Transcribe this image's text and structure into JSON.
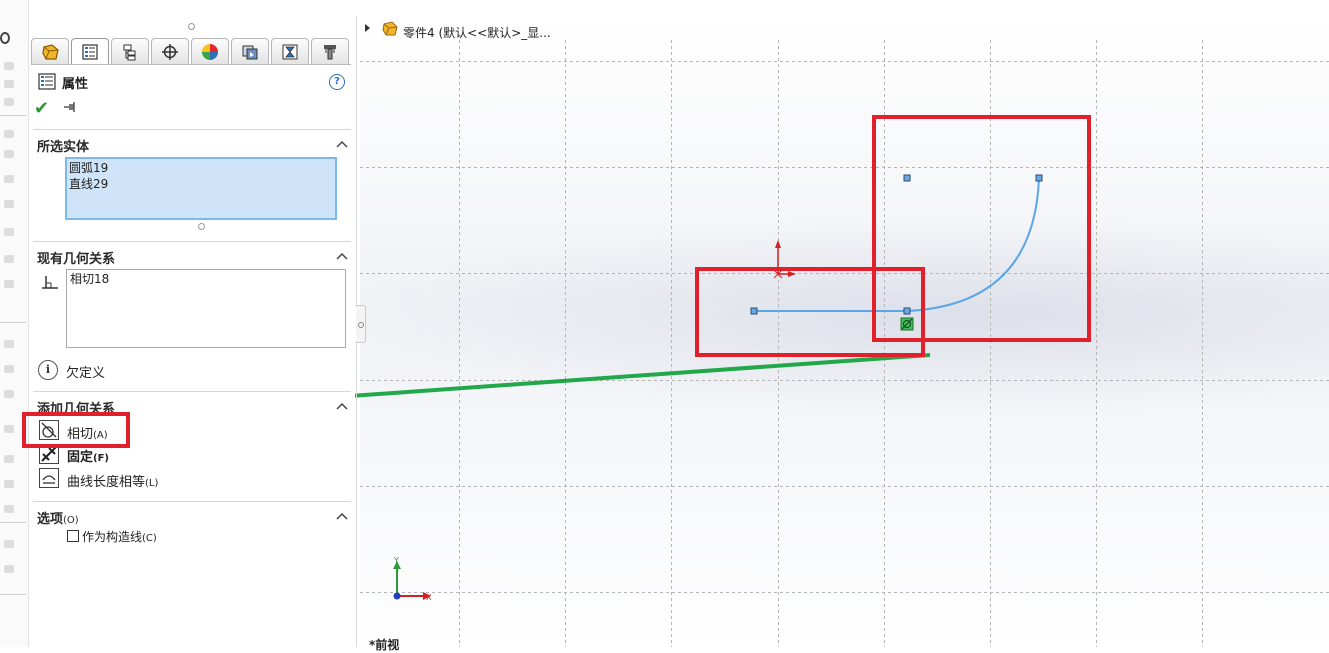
{
  "feature_tree": {
    "part_label": "零件4  (默认<<默认>_显..."
  },
  "tabs": [
    {
      "name": "feature-manager-icon"
    },
    {
      "name": "property-manager-icon"
    },
    {
      "name": "configuration-manager-icon"
    },
    {
      "name": "dimxpert-icon"
    },
    {
      "name": "display-manager-icon"
    },
    {
      "name": "cam-icon"
    },
    {
      "name": "simulation-icon"
    },
    {
      "name": "toolbox-icon"
    }
  ],
  "property_manager": {
    "title": "属性",
    "help_glyph": "?",
    "ok_glyph": "✔"
  },
  "selected_entities": {
    "header": "所选实体",
    "items": [
      "圆弧19",
      "直线29"
    ]
  },
  "existing_relations": {
    "header": "现有几何关系",
    "items": [
      "相切18"
    ],
    "info_glyph": "i",
    "status": "欠定义"
  },
  "add_relations": {
    "header": "添加几何关系",
    "buttons": [
      {
        "label": "相切",
        "shortcut": "(A)"
      },
      {
        "label": "固定",
        "shortcut": "(F)"
      },
      {
        "label": "曲线长度相等",
        "shortcut": "(L)"
      }
    ]
  },
  "options": {
    "header": "选项",
    "shortcut": "(O)",
    "construction_label": "作为构造线",
    "construction_shortcut": "(C)",
    "construction_checked": false
  },
  "viewport": {
    "view_name": "*前视",
    "triad_y": "Y",
    "triad_x": "X",
    "sketch_color": "#5aa6e8",
    "annotation_red": "#e0202a",
    "annotation_green": "#22a84a"
  }
}
